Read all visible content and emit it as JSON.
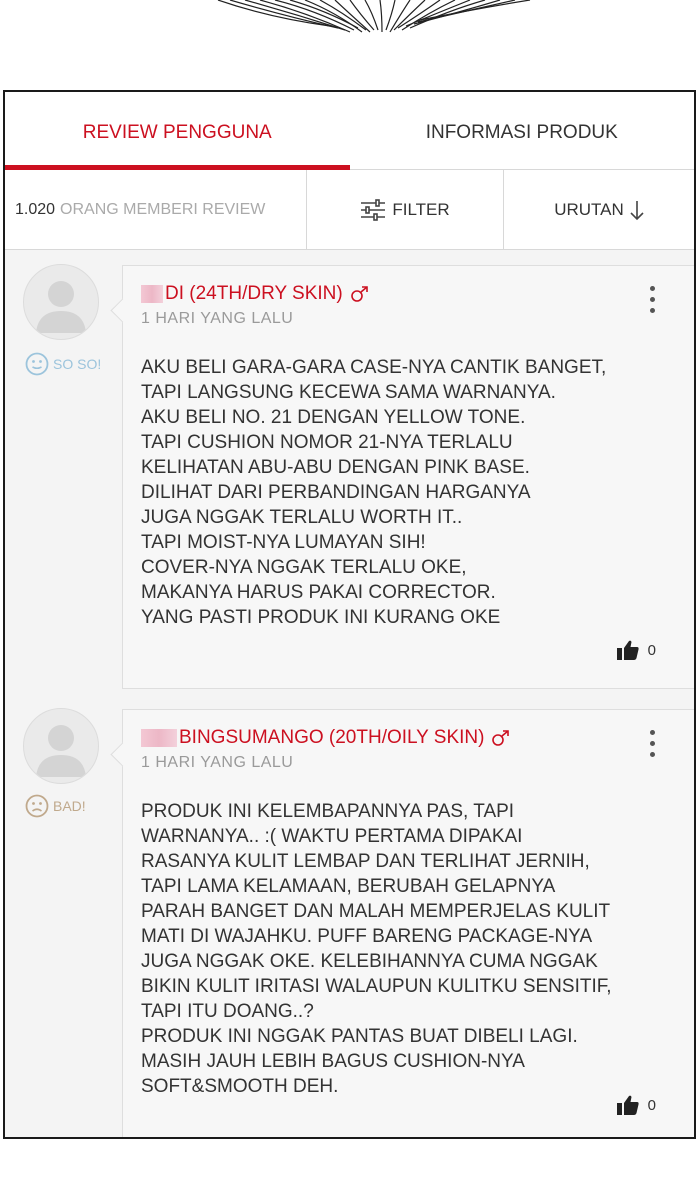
{
  "tabs": {
    "reviews": "REVIEW PENGGUNA",
    "product_info": "INFORMASI PRODUK"
  },
  "toolbar": {
    "count": "1.020",
    "count_label": "ORANG MEMBERI REVIEW",
    "filter": "FILTER",
    "sort": "URUTAN"
  },
  "colors": {
    "accent": "#cc1020",
    "soso": "#9cc4dc",
    "bad": "#c0a98c"
  },
  "reviews": [
    {
      "mood": "SO SO!",
      "mood_icon": "neutral-face-icon",
      "username": "DI (24TH/DRY SKIN)",
      "gender_icon": "male-icon",
      "time": "1 HARI YANG LALU",
      "text": "AKU BELI GARA-GARA CASE-NYA CANTIK BANGET,\nTAPI LANGSUNG KECEWA SAMA WARNANYA.\nAKU BELI NO. 21 DENGAN YELLOW TONE.\nTAPI CUSHION NOMOR 21-NYA TERLALU\nKELIHATAN ABU-ABU DENGAN PINK BASE.\nDILIHAT DARI PERBANDINGAN HARGANYA\nJUGA NGGAK TERLALU WORTH IT..\nTAPI MOIST-NYA LUMAYAN SIH!\nCOVER-NYA NGGAK TERLALU OKE,\nMAKANYA HARUS PAKAI CORRECTOR.\nYANG PASTI PRODUK INI KURANG OKE",
      "likes": "0"
    },
    {
      "mood": "BAD!",
      "mood_icon": "sad-face-icon",
      "username": "BINGSUMANGO (20TH/OILY SKIN)",
      "gender_icon": "male-icon",
      "time": "1 HARI YANG LALU",
      "text": "PRODUK INI KELEMBAPANNYA PAS, TAPI\nWARNANYA.. :( WAKTU PERTAMA DIPAKAI\nRASANYA KULIT LEMBAP DAN TERLIHAT JERNIH,\nTAPI LAMA KELAMAAN, BERUBAH GELAPNYA\nPARAH BANGET DAN MALAH MEMPERJELAS KULIT\nMATI DI WAJAHKU. PUFF BARENG PACKAGE-NYA\nJUGA NGGAK OKE. KELEBIHANNYA CUMA NGGAK\nBIKIN KULIT IRITASI WALAUPUN KULITKU SENSITIF,\nTAPI ITU DOANG..?\nPRODUK INI NGGAK PANTAS BUAT DIBELI LAGI.\nMASIH JAUH LEBIH BAGUS CUSHION-NYA\nSOFT&SMOOTH DEH.",
      "likes": "0"
    }
  ]
}
